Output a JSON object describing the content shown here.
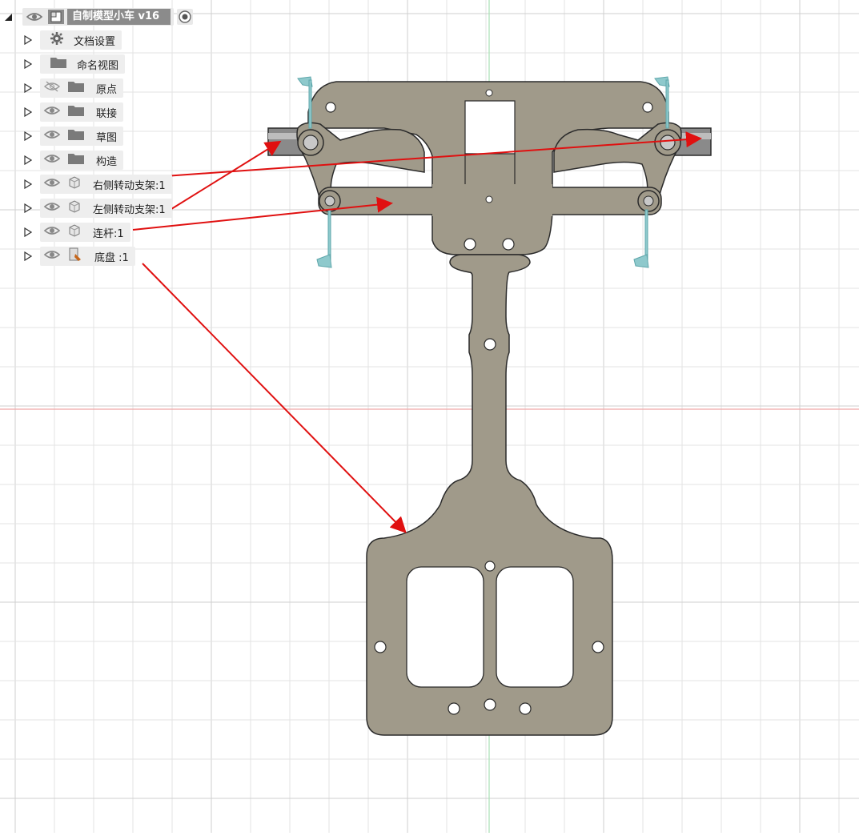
{
  "browser": {
    "root": {
      "title": "自制模型小车 v16",
      "icons": [
        "eye-icon",
        "component-icon",
        "radio-icon"
      ]
    },
    "items": [
      {
        "label": "文档设置",
        "icon": "gear-icon",
        "visible_icon": false
      },
      {
        "label": "命名视图",
        "icon": "folder-icon",
        "visible_icon": false
      },
      {
        "label": "原点",
        "icon": "folder-icon",
        "visible_icon": "hidden"
      },
      {
        "label": "联接",
        "icon": "folder-icon",
        "visible_icon": true
      },
      {
        "label": "草图",
        "icon": "folder-icon",
        "visible_icon": true
      },
      {
        "label": "构造",
        "icon": "folder-icon",
        "visible_icon": true
      },
      {
        "label": "右侧转动支架:1",
        "icon": "body-icon",
        "visible_icon": true
      },
      {
        "label": "左侧转动支架:1",
        "icon": "body-icon",
        "visible_icon": true
      },
      {
        "label": "连杆:1",
        "icon": "body-icon",
        "visible_icon": true
      },
      {
        "label": "底盘 :1",
        "icon": "component-edit-icon",
        "visible_icon": true
      }
    ]
  },
  "colors": {
    "part_fill": "#a09a8a",
    "part_stroke": "#2b2b2b",
    "grid": "#e3e3e3",
    "axis_red": "#f0a8a8",
    "axis_green": "#a8e0b4",
    "arrow": "#e01010",
    "shaft": "#8a8a8a",
    "marker": "#8ec9cc"
  }
}
